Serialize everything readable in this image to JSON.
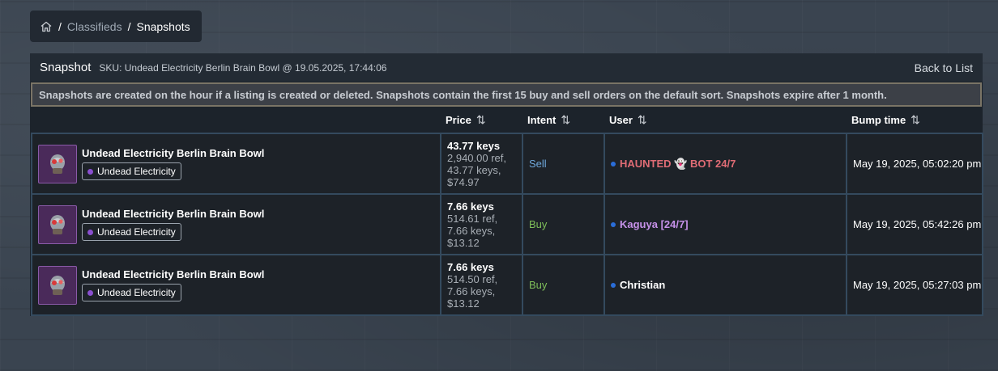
{
  "breadcrumb": {
    "home_icon": "home-icon",
    "separator": "/",
    "classifieds": "Classifieds",
    "current": "Snapshots"
  },
  "panel": {
    "title": "Snapshot",
    "sku": "SKU: Undead Electricity Berlin Brain Bowl @ 19.05.2025, 17:44:06",
    "back_link": "Back to List",
    "notice": "Snapshots are created on the hour if a listing is created or deleted. Snapshots contain the first 15 buy and sell orders on the default sort. Snapshots expire after 1 month."
  },
  "table": {
    "headers": {
      "price": "Price",
      "intent": "Intent",
      "user": "User",
      "bump": "Bump time",
      "sort_icon": "⇅"
    },
    "rows": [
      {
        "item": "Undead Electricity Berlin Brain Bowl",
        "effect": "Undead Electricity",
        "price_main": "43.77 keys",
        "price_ref": "2,940.00 ref,",
        "price_keys": "43.77 keys,",
        "price_usd": "$74.97",
        "intent": "Sell",
        "user": "HAUNTED 👻 BOT 24/7",
        "user_color": "#e06c75",
        "bump": "May 19, 2025, 05:02:20 pm"
      },
      {
        "item": "Undead Electricity Berlin Brain Bowl",
        "effect": "Undead Electricity",
        "price_main": "7.66 keys",
        "price_ref": "514.61 ref,",
        "price_keys": "7.66 keys,",
        "price_usd": "$13.12",
        "intent": "Buy",
        "user": "Kaguya [24/7]",
        "user_color": "#c792ea",
        "bump": "May 19, 2025, 05:42:26 pm"
      },
      {
        "item": "Undead Electricity Berlin Brain Bowl",
        "effect": "Undead Electricity",
        "price_main": "7.66 keys",
        "price_ref": "514.50 ref,",
        "price_keys": "7.66 keys,",
        "price_usd": "$13.12",
        "intent": "Buy",
        "user": "Christian",
        "user_color": "#ffffff",
        "bump": "May 19, 2025, 05:27:03 pm"
      }
    ]
  }
}
